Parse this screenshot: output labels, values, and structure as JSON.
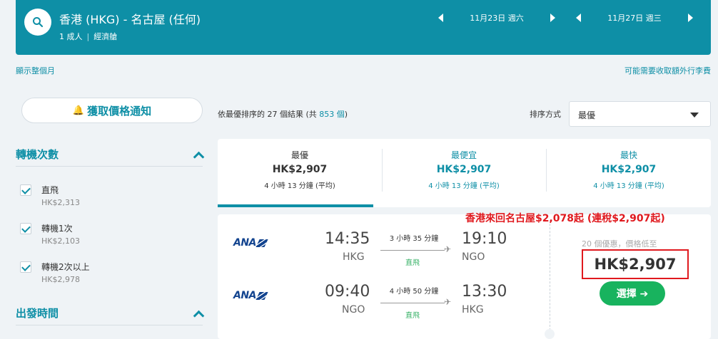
{
  "header": {
    "route": "香港 (HKG) - 名古屋 (任何)",
    "passengers": "1 成人",
    "cabin": "經濟艙",
    "depart_date": "11月23日 週六",
    "return_date": "11月27日 週三"
  },
  "links": {
    "show_month": "顯示整個月",
    "baggage_fees": "可能需要收取額外行李費"
  },
  "sidebar": {
    "price_alert_label": "獲取價格通知",
    "stops_title": "轉機次數",
    "stops": [
      {
        "label": "直飛",
        "price": "HK$2,313"
      },
      {
        "label": "轉機1次",
        "price": "HK$2,103"
      },
      {
        "label": "轉機2次以上",
        "price": "HK$2,978"
      }
    ],
    "departure_title": "出發時間"
  },
  "results": {
    "prefix": "依最優排序的 27 個結果 (共 ",
    "total": "853 個",
    "suffix": ")",
    "sort_label": "排序方式",
    "sort_value": "最優"
  },
  "tabs": [
    {
      "title": "最優",
      "price": "HK$2,907",
      "duration": "4 小時 13 分鐘 (平均)"
    },
    {
      "title": "最便宜",
      "price": "HK$2,907",
      "duration": "4 小時 13 分鐘 (平均)"
    },
    {
      "title": "最快",
      "price": "HK$2,907",
      "duration": "4 小時 13 分鐘 (平均)"
    }
  ],
  "promo": "香港來回名古屋$2,078起 (連稅$2,907起)",
  "flight_card": {
    "legs": [
      {
        "airline": "ANA",
        "dep_time": "14:35",
        "dep_code": "HKG",
        "duration": "3 小時 35 分鐘",
        "stops": "直飛",
        "arr_time": "19:10",
        "arr_code": "NGO"
      },
      {
        "airline": "ANA",
        "dep_time": "09:40",
        "dep_code": "NGO",
        "duration": "4 小時 50 分鐘",
        "stops": "直飛",
        "arr_time": "13:30",
        "arr_code": "HKG"
      }
    ],
    "deals_text": "20 個優惠，價格低至",
    "price": "HK$2,907",
    "select_label": "選擇 ➔"
  }
}
